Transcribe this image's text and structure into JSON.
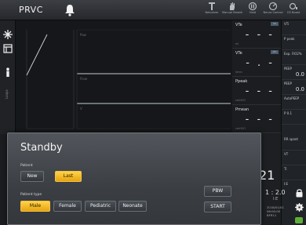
{
  "topbar": {
    "mode": "PRVC",
    "buttons": [
      {
        "label": "Nebulizer",
        "icon": "nebulizer-icon"
      },
      {
        "label": "Manual Breath",
        "icon": "hand-icon"
      },
      {
        "label": "Hold",
        "icon": "hold-icon"
      },
      {
        "label": "Neuro Control",
        "icon": "knob-icon"
      },
      {
        "label": "O2 Boost",
        "icon": "o2-icon"
      }
    ]
  },
  "leftbar": {
    "icons": [
      "star-icon",
      "layout-icon",
      "person-icon"
    ],
    "vertical_label": "Loops"
  },
  "waves": {
    "tags": [
      "Paw",
      "Flow",
      "V"
    ]
  },
  "params": [
    {
      "name": "VTe",
      "value": "- - -",
      "unit": "ml",
      "badge": "ml"
    },
    {
      "name": "VTe",
      "value": "- . -",
      "unit": "l/min",
      "badge": "l/m"
    },
    {
      "name": "Ppeak",
      "value": "- - -",
      "unit": "cmH2O",
      "badge": ""
    },
    {
      "name": "Pmean",
      "value": "- - -",
      "unit": "cmH2O",
      "badge": ""
    }
  ],
  "settings": [
    {
      "name": "VTi",
      "value": ""
    },
    {
      "name": "P peak",
      "value": ""
    },
    {
      "name": "Exp. FiO2%",
      "value": ""
    },
    {
      "name": "PEEP",
      "value": "0.0"
    },
    {
      "name": "PEEP",
      "value": "0.0"
    },
    {
      "name": "AutoPEEP",
      "value": ""
    },
    {
      "name": "P 0.1",
      "value": ""
    },
    {
      "name": "RR spont",
      "value": ""
    },
    {
      "name": "VT",
      "value": ""
    },
    {
      "name": "Ti",
      "value": ""
    },
    {
      "name": "I:E",
      "value": ""
    }
  ],
  "status": {
    "big_value": "21",
    "ratio": "1 : 2.0",
    "ratio_unit": "I:E",
    "date_line1": "2018/01/01",
    "date_line2": "06:00:00",
    "date_line3": "BFR11"
  },
  "dialog": {
    "title": "Standby",
    "patient_label": "Patient",
    "patient_new": "New",
    "patient_last": "Last",
    "patient_type_label": "Patient type",
    "type_male": "Male",
    "type_female": "Female",
    "type_pediatric": "Pediatric",
    "type_neonate": "Neonate",
    "pbw": "PBW",
    "start": "START"
  },
  "colors": {
    "selected": "#f5b82a",
    "panel": "#3b3e43",
    "background": "#1a1c1f"
  }
}
